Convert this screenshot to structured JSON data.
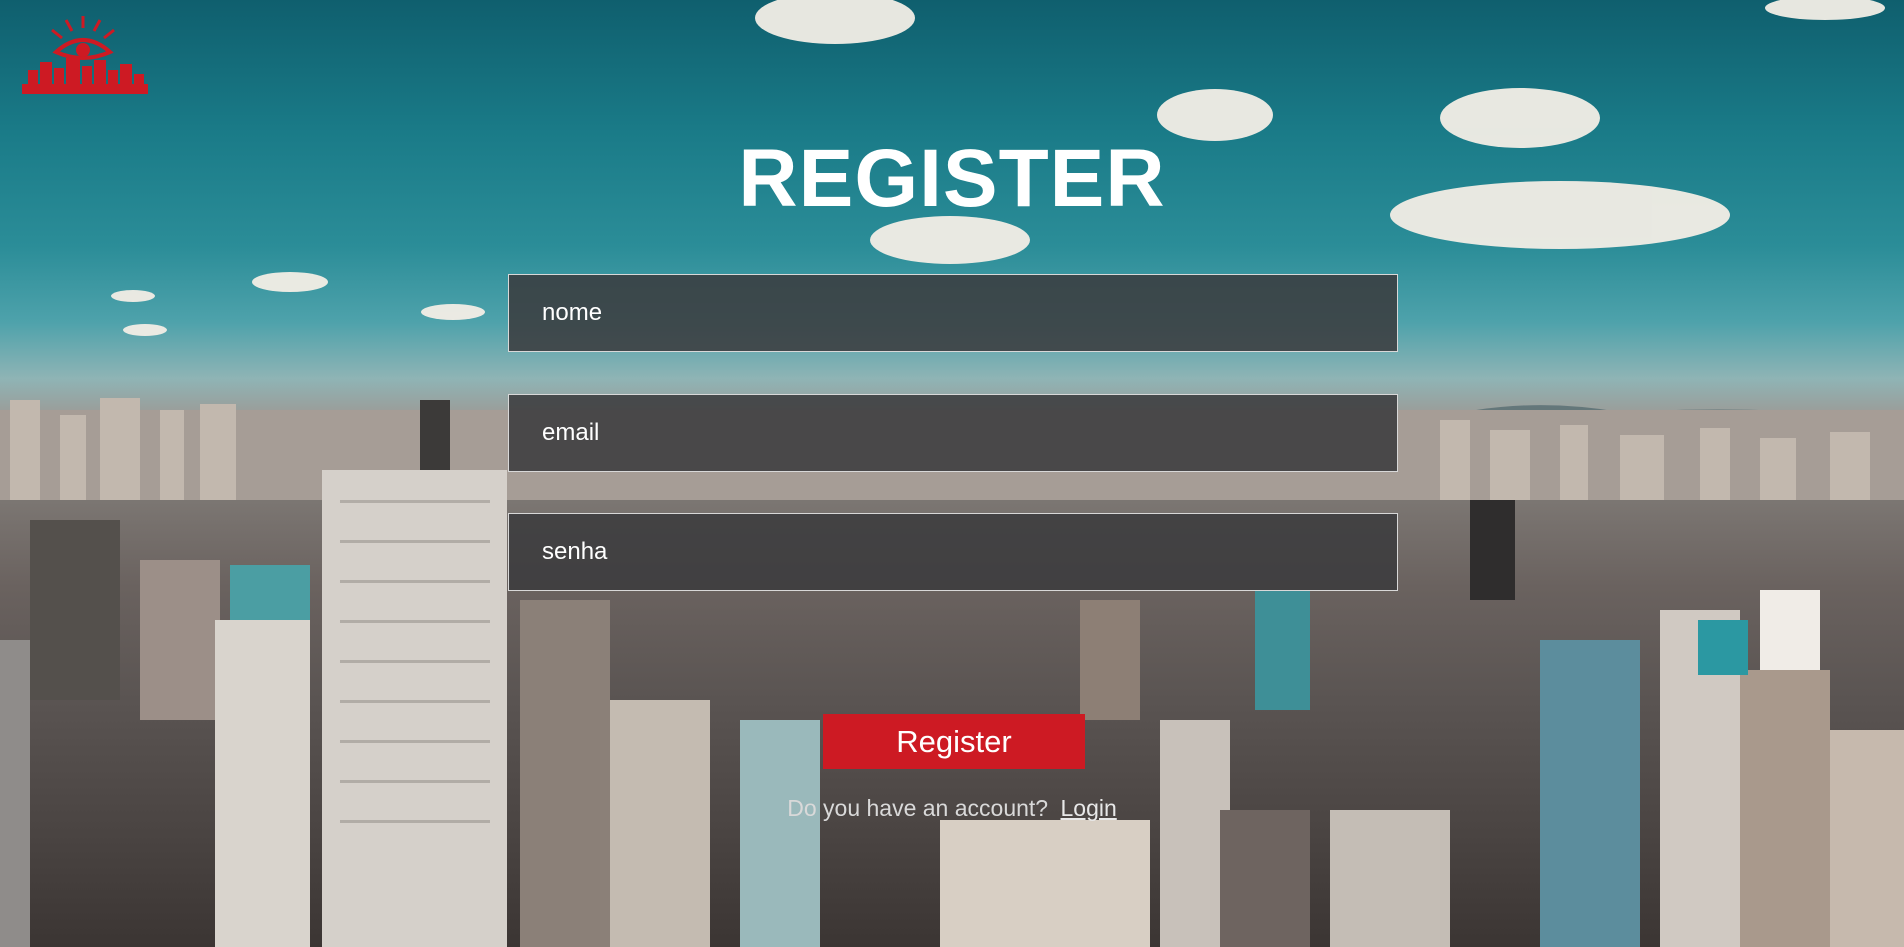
{
  "brand": {
    "logo_icon": "eye-city-skyline-logo",
    "logo_color": "#cd1a23"
  },
  "form": {
    "title": "REGISTER",
    "name_placeholder": "nome",
    "email_placeholder": "email",
    "password_placeholder": "senha",
    "submit_label": "Register"
  },
  "footer": {
    "question": "Do you have an account?",
    "login_link": "Login"
  },
  "colors": {
    "accent": "#cd1a23",
    "field_background": "#3a3a3c",
    "text": "#ffffff"
  }
}
